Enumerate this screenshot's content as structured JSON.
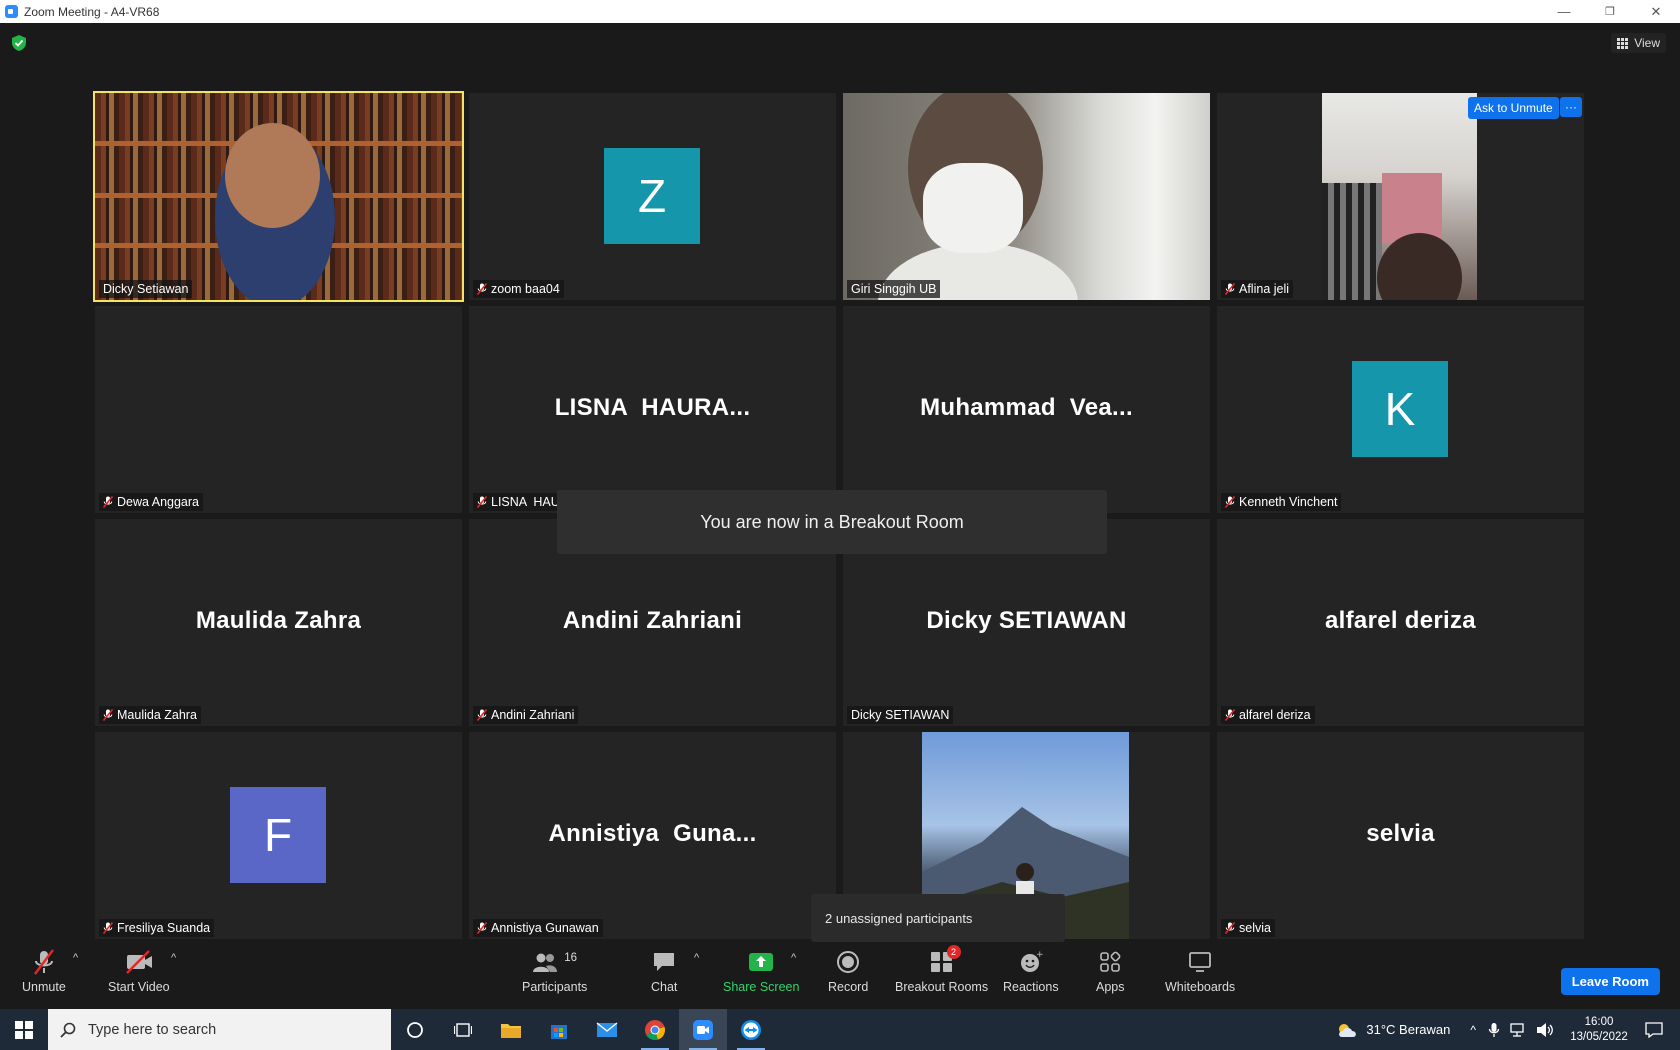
{
  "window": {
    "title": "Zoom Meeting - A4-VR68",
    "controls": [
      "—",
      "❐",
      "✕"
    ]
  },
  "header": {
    "view_label": "View"
  },
  "tiles": [
    {
      "id": "dicky-setiawan",
      "label": "Dicky Setiawan",
      "muted": false,
      "big": "",
      "avatar": "",
      "video": "books",
      "active": true
    },
    {
      "id": "zoom-baa04",
      "label": "zoom baa04",
      "muted": true,
      "big": "",
      "avatar": "Z",
      "avatar_color": "#1596ab"
    },
    {
      "id": "giri-singgih",
      "label": "Giri Singgih UB",
      "muted": false,
      "big": "",
      "avatar": "",
      "video": "giri"
    },
    {
      "id": "aflina-jeli",
      "label": "Aflina jeli",
      "muted": true,
      "big": "",
      "avatar": "",
      "video": "aflina"
    },
    {
      "id": "dewa-anggara",
      "label": "Dewa Anggara",
      "muted": true,
      "big": "",
      "avatar": ""
    },
    {
      "id": "lisna-haura",
      "label": "LISNA  HAURA NISSA",
      "muted": true,
      "big": "LISNA  HAURA...",
      "avatar": ""
    },
    {
      "id": "muhammad-vearell",
      "label": "Muhammad Vearell Ramadhan",
      "muted": true,
      "big": "Muhammad  Vea...",
      "avatar": ""
    },
    {
      "id": "kenneth-vinchent",
      "label": "Kenneth Vinchent",
      "muted": true,
      "big": "",
      "avatar": "K",
      "avatar_color": "#1596ab"
    },
    {
      "id": "maulida-zahra",
      "label": "Maulida Zahra",
      "muted": true,
      "big": "Maulida Zahra",
      "avatar": ""
    },
    {
      "id": "andini-zahriani",
      "label": "Andini Zahriani",
      "muted": true,
      "big": "Andini Zahriani",
      "avatar": ""
    },
    {
      "id": "dicky-setiawan-2",
      "label": "Dicky SETIAWAN",
      "muted": false,
      "big": "Dicky SETIAWAN",
      "avatar": ""
    },
    {
      "id": "alfarel-deriza",
      "label": "alfarel deriza",
      "muted": true,
      "big": "alfarel deriza",
      "avatar": ""
    },
    {
      "id": "fresiliya-suanda",
      "label": "Fresiliya Suanda",
      "muted": true,
      "big": "",
      "avatar": "F",
      "avatar_color": "#5b67c7"
    },
    {
      "id": "annistiya-gunawan",
      "label": "Annistiya Gunawan",
      "muted": true,
      "big": "Annistiya  Guna...",
      "avatar": ""
    },
    {
      "id": "mountain-photo",
      "label": "",
      "muted": false,
      "big": "",
      "avatar": "",
      "video": "mountain"
    },
    {
      "id": "selvia",
      "label": "selvia",
      "muted": true,
      "big": "selvia",
      "avatar": ""
    }
  ],
  "overlays": {
    "breakout_banner": "You are now in a Breakout Room",
    "ask_to_unmute": "Ask to Unmute",
    "more": "···",
    "unassigned": "2 unassigned participants"
  },
  "toolbar": {
    "unmute": "Unmute",
    "start_video": "Start Video",
    "participants": "Participants",
    "participants_count": "16",
    "chat": "Chat",
    "share_screen": "Share Screen",
    "record": "Record",
    "breakout_rooms": "Breakout Rooms",
    "breakout_badge": "2",
    "reactions": "Reactions",
    "apps": "Apps",
    "whiteboards": "Whiteboards",
    "leave_room": "Leave Room"
  },
  "taskbar": {
    "search_placeholder": "Type here to search",
    "weather": "31°C  Berawan",
    "time": "16:00",
    "date": "13/05/2022"
  },
  "colors": {
    "accent": "#0e72ed",
    "share_green": "#36d26c",
    "active_border": "#f5e463",
    "badge_red": "#e02828"
  }
}
